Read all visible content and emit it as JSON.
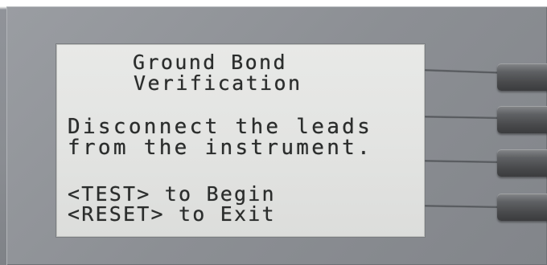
{
  "display": {
    "title_line1": "Ground Bond",
    "title_line2": "Verification",
    "message_line1": "Disconnect the leads",
    "message_line2": "from the instrument.",
    "command_test": "<TEST> to Begin",
    "command_reset": "<RESET> to Exit"
  },
  "colors": {
    "lcd_background": "#e3e4e2",
    "lcd_text": "#2b2d2c",
    "panel": "#8c8f94",
    "softkey": "#4a4b4d"
  },
  "softkeys": [
    {
      "icon": "softkey-button"
    },
    {
      "icon": "softkey-button"
    },
    {
      "icon": "softkey-button"
    },
    {
      "icon": "softkey-button"
    }
  ]
}
